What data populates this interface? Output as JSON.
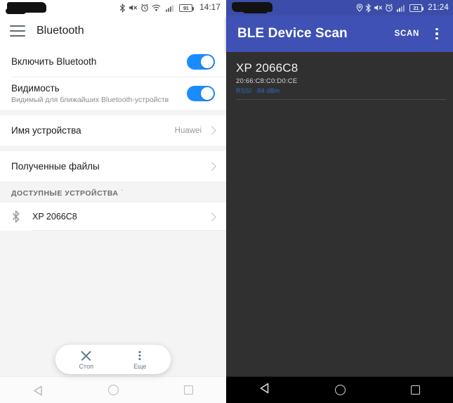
{
  "left": {
    "status_bar": {
      "icons": [
        "bluetooth-icon",
        "mute-icon",
        "alarm-icon",
        "wifi-icon",
        "signal-icon"
      ],
      "battery_level": "91",
      "time": "14:17"
    },
    "appbar": {
      "menu_icon": "hamburger-icon",
      "title": "Bluetooth"
    },
    "rows": [
      {
        "title": "Включить Bluetooth",
        "sub": "",
        "value": "",
        "control": "toggle",
        "toggle_on": true
      },
      {
        "title": "Видимость",
        "sub": "Видимый для ближайших Bluetooth-устройств",
        "value": "",
        "control": "toggle",
        "toggle_on": true
      },
      {
        "title": "Имя устройства",
        "sub": "",
        "value": "Huawei",
        "control": "chevron",
        "toggle_on": false
      },
      {
        "title": "Полученные файлы",
        "sub": "",
        "value": "",
        "control": "chevron",
        "toggle_on": false
      }
    ],
    "section_header": "ДОСТУПНЫЕ УСТРОЙСТВА",
    "section_header_mark": "˙",
    "devices": [
      {
        "name": "XP 2066C8",
        "icon": "bluetooth-icon"
      }
    ],
    "fab": [
      {
        "label": "Стоп",
        "icon": "close-x-icon"
      },
      {
        "label": "Еще",
        "icon": "overflow-kebab-icon"
      }
    ],
    "navbar": [
      "back-triangle-icon",
      "home-circle-icon",
      "recents-square-icon"
    ],
    "colors": {
      "toggle_on": "#1a8cff",
      "appbar_bg": "#ffffff",
      "body_bg": "#f4f4f4"
    }
  },
  "right": {
    "status_bar": {
      "icons": [
        "location-icon",
        "bluetooth-icon",
        "mute-icon",
        "alarm-icon",
        "signal-icon"
      ],
      "battery_level": "21",
      "time": "21:24"
    },
    "appbar": {
      "title": "BLE Device Scan",
      "scan_label": "SCAN",
      "overflow_icon": "overflow-kebab-icon"
    },
    "devices": [
      {
        "name": "XP 2066C8",
        "address": "20:66:C8:C0:D0:CE",
        "rssi": "RSSI: -84 dBm"
      }
    ],
    "navbar": [
      "back-triangle-icon",
      "home-circle-icon",
      "recents-square-icon"
    ],
    "colors": {
      "appbar_bg": "#3f51b5",
      "statusbar_bg": "#3b4da8",
      "body_bg": "#303030",
      "rssi_text": "#2f6fd0"
    }
  }
}
